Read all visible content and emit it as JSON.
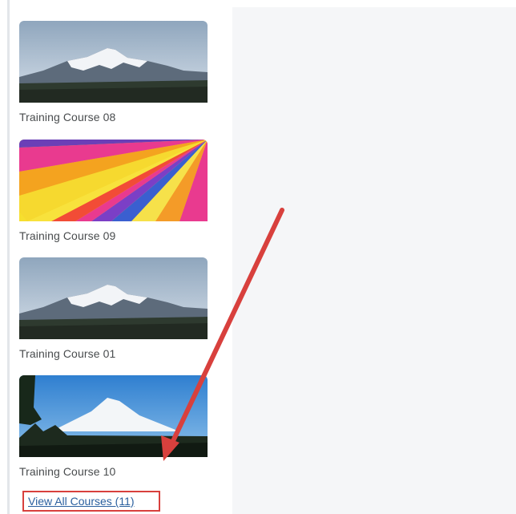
{
  "courses": [
    {
      "title": "Training Course 08",
      "image": "mountain-snow"
    },
    {
      "title": "Training Course 09",
      "image": "hot-air-balloon"
    },
    {
      "title": "Training Course 01",
      "image": "mountain-snow"
    },
    {
      "title": "Training Course 10",
      "image": "mountain-forest"
    }
  ],
  "view_all_label": "View All Courses (11)",
  "colors": {
    "link": "#2a5f9e",
    "highlight": "#d8403d",
    "panel_bg": "#ffffff",
    "page_bg": "#f4f5f7"
  }
}
